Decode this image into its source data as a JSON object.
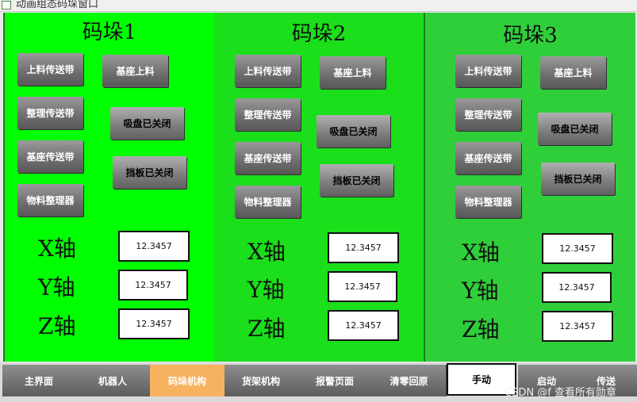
{
  "window": {
    "title": "动画组态码垛窗口"
  },
  "colors": {
    "panel1": "#00ff00",
    "panel2": "#1adf1a",
    "panel3": "#2fcf3a",
    "nav_active": "#f7b260"
  },
  "panels": [
    {
      "title": "码垛1",
      "left_buttons": [
        "上料传送带",
        "整理传送带",
        "基座传送带",
        "物料整理器"
      ],
      "right_buttons": [
        "基座上料",
        "吸盘已关闭",
        "挡板已关闭"
      ],
      "axes": [
        {
          "label": "X轴",
          "value": "12.3457"
        },
        {
          "label": "Y轴",
          "value": "12.3457"
        },
        {
          "label": "Z轴",
          "value": "12.3457"
        }
      ]
    },
    {
      "title": "码垛2",
      "left_buttons": [
        "上料传送带",
        "整理传送带",
        "基座传送带",
        "物料整理器"
      ],
      "right_buttons": [
        "基座上料",
        "吸盘已关闭",
        "挡板已关闭"
      ],
      "axes": [
        {
          "label": "X轴",
          "value": "12.3457"
        },
        {
          "label": "Y轴",
          "value": "12.3457"
        },
        {
          "label": "Z轴",
          "value": "12.3457"
        }
      ]
    },
    {
      "title": "码垛3",
      "left_buttons": [
        "上料传送带",
        "整理传送带",
        "基座传送带",
        "物料整理器"
      ],
      "right_buttons": [
        "基座上料",
        "吸盘已关闭",
        "挡板已关闭"
      ],
      "axes": [
        {
          "label": "X轴",
          "value": "12.3457"
        },
        {
          "label": "Y轴",
          "value": "12.3457"
        },
        {
          "label": "Z轴",
          "value": "12.3457"
        }
      ]
    }
  ],
  "nav": [
    "主界面",
    "机器人",
    "码垛机构",
    "货架机构",
    "报警页面",
    "清零回原",
    "手动",
    "启动",
    "传送"
  ],
  "nav_active": "码垛机构",
  "nav_selected": "手动",
  "watermark": "CSDN @f 查看所有勋章"
}
